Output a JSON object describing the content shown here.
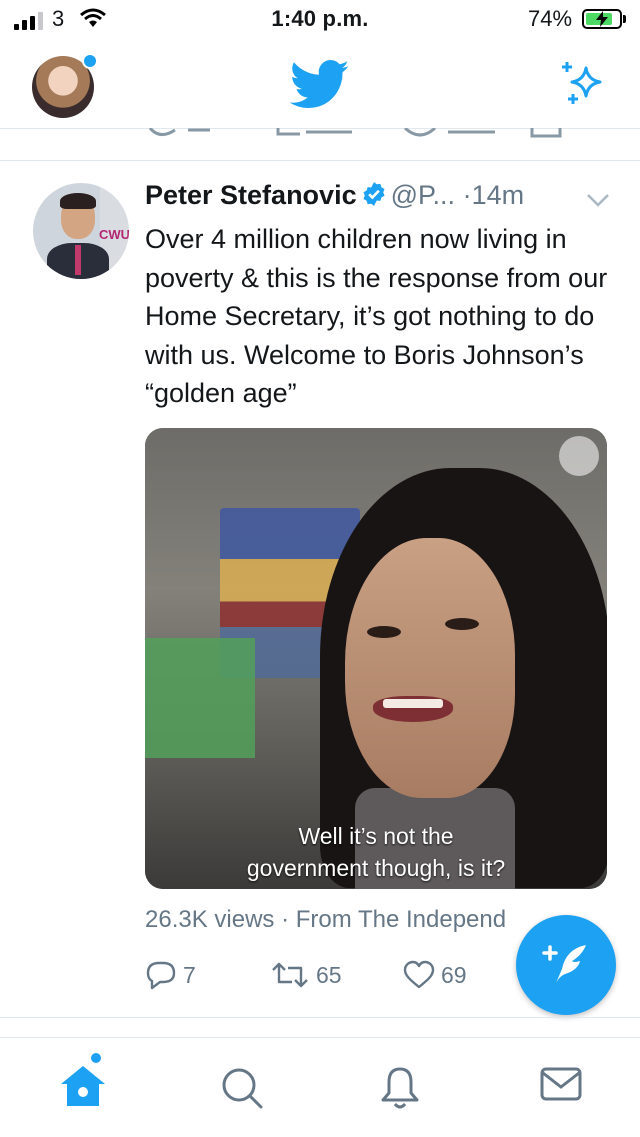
{
  "status_bar": {
    "carrier": "3",
    "time": "1:40 p.m.",
    "battery_percent": "74%",
    "signal_bars": 3,
    "battery_level": 0.74
  },
  "nav": {
    "avatar": "profile-avatar",
    "logo": "twitter-bird-icon",
    "right_icon": "sparkle-icon"
  },
  "tweet": {
    "author_name": "Peter Stefanovic",
    "handle": "@P...",
    "separator": "·",
    "time_ago": "14m",
    "text": "Over 4 million children now living in poverty & this is the response from our Home Secretary, it’s got nothing to do with us. Welcome to Boris Johnson’s “golden age”",
    "media": {
      "subtitle_line1": "Well it’s not the",
      "subtitle_line2": "government though, is it?"
    },
    "views_line": "26.3K views · From The Independ",
    "replies": "7",
    "retweets": "65",
    "likes": "69"
  },
  "tabs": [
    {
      "name": "home",
      "icon": "home-icon"
    },
    {
      "name": "search",
      "icon": "search-icon"
    },
    {
      "name": "notifications",
      "icon": "bell-icon"
    },
    {
      "name": "messages",
      "icon": "mail-icon"
    }
  ],
  "colors": {
    "accent": "#1da1f2",
    "muted": "#657786",
    "text": "#14171a",
    "divider": "#e1e8ed"
  }
}
